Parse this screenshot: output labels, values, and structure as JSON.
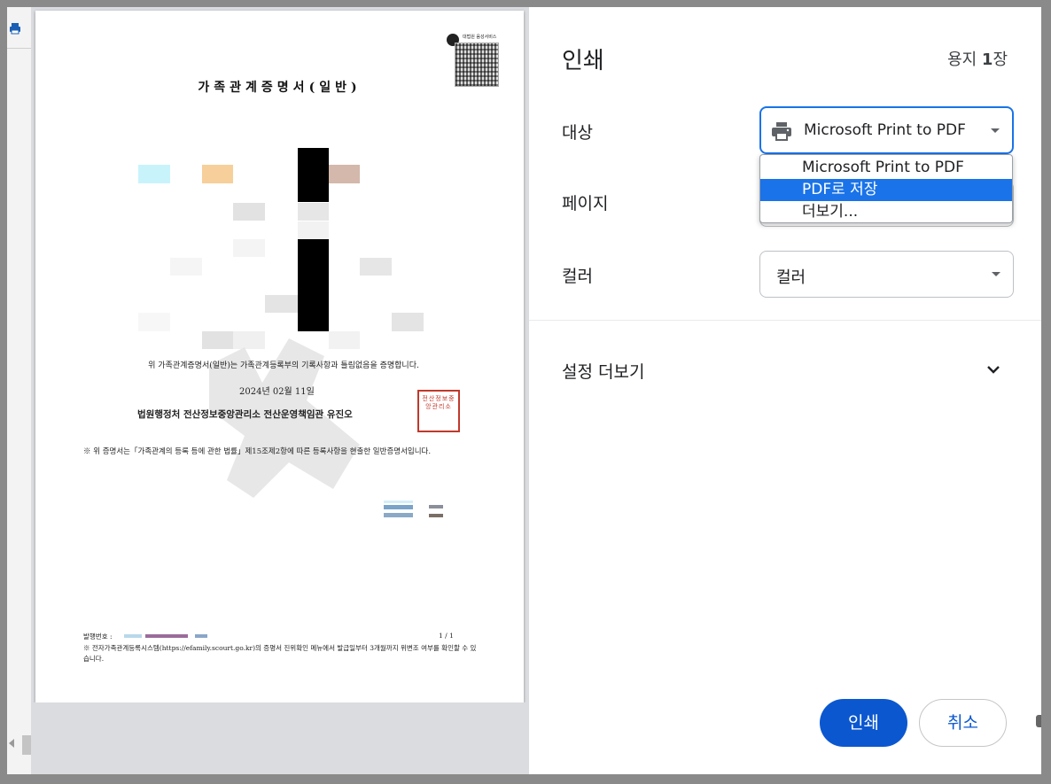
{
  "document": {
    "title": "가족관계증명서(일반)",
    "qr_label": "대법원 음성서비스",
    "statement": "위 가족관계증명서(일반)는 가족관계등록부의 기록사항과 틀림없음을 증명합니다.",
    "date": "2024년 02월 11일",
    "issuer": "법원행정처 전산정보중앙관리소 전산운영책임관 유진오",
    "seal_text": "전산정보중앙관리소",
    "note": "※ 위 증명서는「가족관계의 등록 등에 관한 법률」제15조제2항에 따른 등록사항을 현출한 일반증명서입니다.",
    "issue_no_label": "발행번호 :",
    "page_no": "1 / 1",
    "footer": "※ 전자가족관계등록시스템(https://efamily.scourt.go.kr)의 증명서 진위확인 메뉴에서 발급일부터 3개월까지 위변조 여부를 확인할 수 있습니다."
  },
  "settings": {
    "title": "인쇄",
    "sheet_count_prefix": "용지 ",
    "sheet_count_num": "1",
    "sheet_count_suffix": "장",
    "destination_label": "대상",
    "destination_value": "Microsoft Print to PDF",
    "dropdown_options": [
      "Microsoft Print to PDF",
      "PDF로 저장",
      "더보기..."
    ],
    "selected_option_index": 1,
    "pages_label": "페이지",
    "color_label": "컬러",
    "color_value": "컬러",
    "more_settings_label": "설정 더보기",
    "print_button": "인쇄",
    "cancel_button": "취소"
  },
  "colors": {
    "accent": "#1a73e8",
    "print_button": "#0b57d0",
    "preview_background": "#dadce0"
  },
  "icons": {
    "destination": "printer-icon",
    "more_settings": "chevron-down-icon",
    "sidebar": "printer-icon"
  }
}
